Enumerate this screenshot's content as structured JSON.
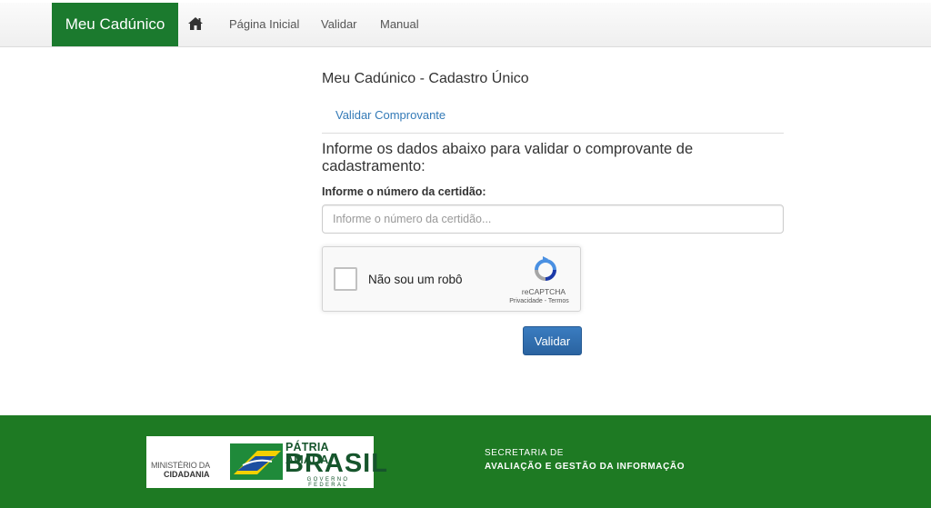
{
  "navbar": {
    "brand": "Meu Cadúnico",
    "home_icon": "home-icon",
    "links": [
      "Página Inicial",
      "Validar",
      "Manual"
    ]
  },
  "main": {
    "heading": "Meu Cadúnico - Cadastro Único",
    "tab": "Validar Comprovante",
    "instructions": "Informe os dados abaixo para validar o comprovante de cadastramento:",
    "field_label": "Informe o número da certidão:",
    "field_placeholder": "Informe o número da certidão...",
    "captcha": {
      "label": "Não sou um robô",
      "brand": "reCAPTCHA",
      "links": "Privacidade - Termos",
      "logo_icon": "recaptcha-icon"
    },
    "submit_label": "Validar"
  },
  "footer": {
    "ministry_line1": "MINISTÉRIO DA",
    "ministry_line2": "CIDADANIA",
    "slogan_line1": "PÁTRIA AMADA",
    "slogan_line2": "BRASIL",
    "slogan_line3": "GOVERNO FEDERAL",
    "secretariat_line1": "SECRETARIA DE",
    "secretariat_line2": "AVALIAÇÃO E GESTÃO DA INFORMAÇÃO",
    "flag_icon": "brazil-flag-icon"
  },
  "colors": {
    "brand_green": "#1b7a2e",
    "footer_green": "#1e7a23",
    "link_blue": "#337ab7",
    "button_blue": "#2f6fb0"
  }
}
